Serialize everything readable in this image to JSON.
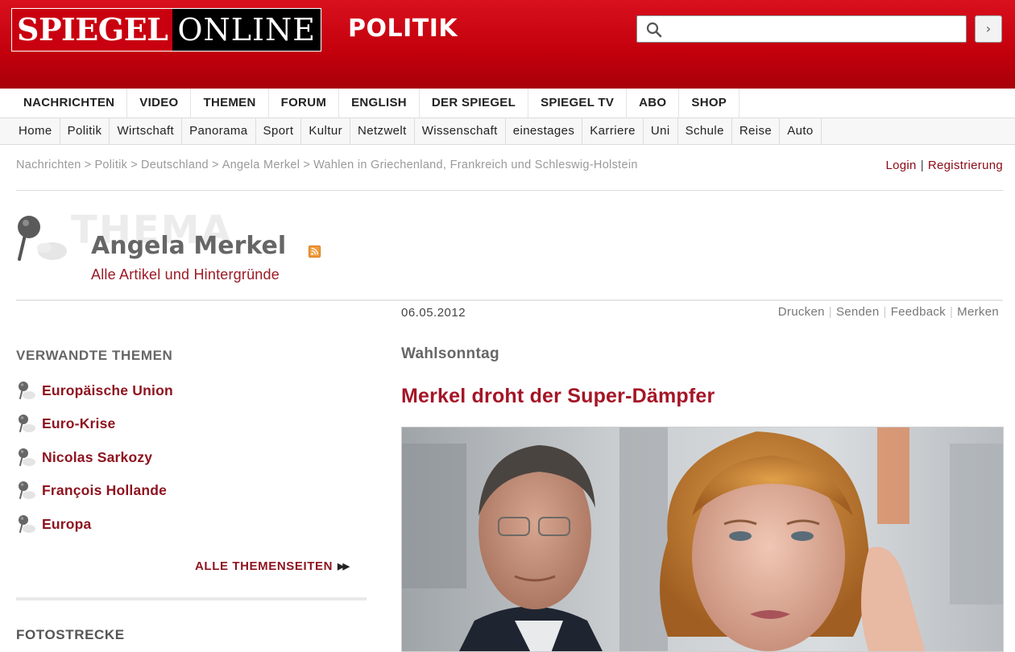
{
  "header": {
    "logo_part1": "SPIEGEL",
    "logo_part2": "ONLINE",
    "section": "POLITIK",
    "search_placeholder": "",
    "search_submit": "›"
  },
  "main_nav": [
    "NACHRICHTEN",
    "VIDEO",
    "THEMEN",
    "FORUM",
    "ENGLISH",
    "DER SPIEGEL",
    "SPIEGEL TV",
    "ABO",
    "SHOP"
  ],
  "sub_nav": [
    "Home",
    "Politik",
    "Wirtschaft",
    "Panorama",
    "Sport",
    "Kultur",
    "Netzwelt",
    "Wissenschaft",
    "einestages",
    "Karriere",
    "Uni",
    "Schule",
    "Reise",
    "Auto"
  ],
  "breadcrumb": [
    "Nachrichten",
    "Politik",
    "Deutschland",
    "Angela Merkel",
    "Wahlen in Griechenland, Frankreich und Schleswig-Holstein"
  ],
  "breadcrumb_separator": ">",
  "account": {
    "login": "Login",
    "separator": "|",
    "register": "Registrierung"
  },
  "thema": {
    "watermark": "THEMA",
    "title": "Angela Merkel",
    "subtitle": "Alle Artikel und Hintergründe",
    "rss_icon": "rss-icon"
  },
  "related": {
    "heading": "VERWANDTE THEMEN",
    "items": [
      "Europäische Union",
      "Euro-Krise",
      "Nicolas Sarkozy",
      "François Hollande",
      "Europa"
    ],
    "all_link": "ALLE THEMENSEITEN",
    "all_link_icon": "▶▶"
  },
  "fotostrecke": {
    "heading": "FOTOSTRECKE"
  },
  "article": {
    "date": "06.05.2012",
    "tools": [
      "Drucken",
      "Senden",
      "Feedback",
      "Merken"
    ],
    "tools_separator": "|",
    "kicker": "Wahlsonntag",
    "headline": "Merkel droht der Super-Dämpfer"
  },
  "colors": {
    "brand_red": "#c2000c",
    "link_red": "#8e1420",
    "headline_red": "#a41526"
  }
}
